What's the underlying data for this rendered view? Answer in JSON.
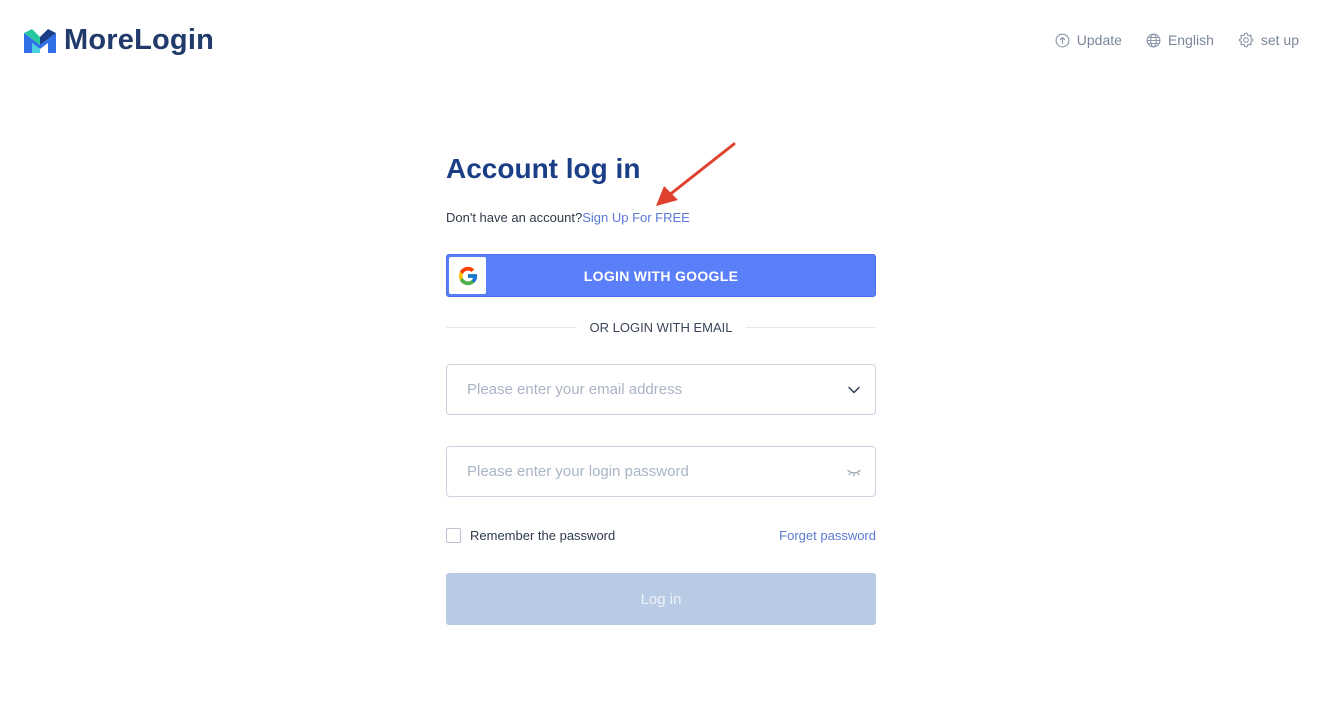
{
  "brand": {
    "name": "MoreLogin"
  },
  "top_actions": [
    {
      "label": "Update",
      "icon": "upload-circle-icon"
    },
    {
      "label": "English",
      "icon": "globe-icon"
    },
    {
      "label": "set up",
      "icon": "gear-icon"
    }
  ],
  "form": {
    "title": "Account log in",
    "signup_prompt": "Don't have an account?",
    "signup_link": "Sign Up For FREE",
    "google_button": "LOGIN WITH GOOGLE",
    "divider_text": "OR LOGIN WITH EMAIL",
    "email": {
      "placeholder": "Please enter your email address",
      "value": ""
    },
    "password": {
      "placeholder": "Please enter your login password",
      "value": ""
    },
    "remember_label": "Remember the password",
    "remember_checked": false,
    "forgot_link": "Forget password",
    "login_button": "Log in"
  },
  "colors": {
    "brand_text": "#1f3a6b",
    "title": "#1a3f86",
    "link": "#5a79d6",
    "google_button": "#5b7ef9",
    "login_button_disabled": "#b8cae4",
    "annotation_arrow": "#e0412e"
  }
}
